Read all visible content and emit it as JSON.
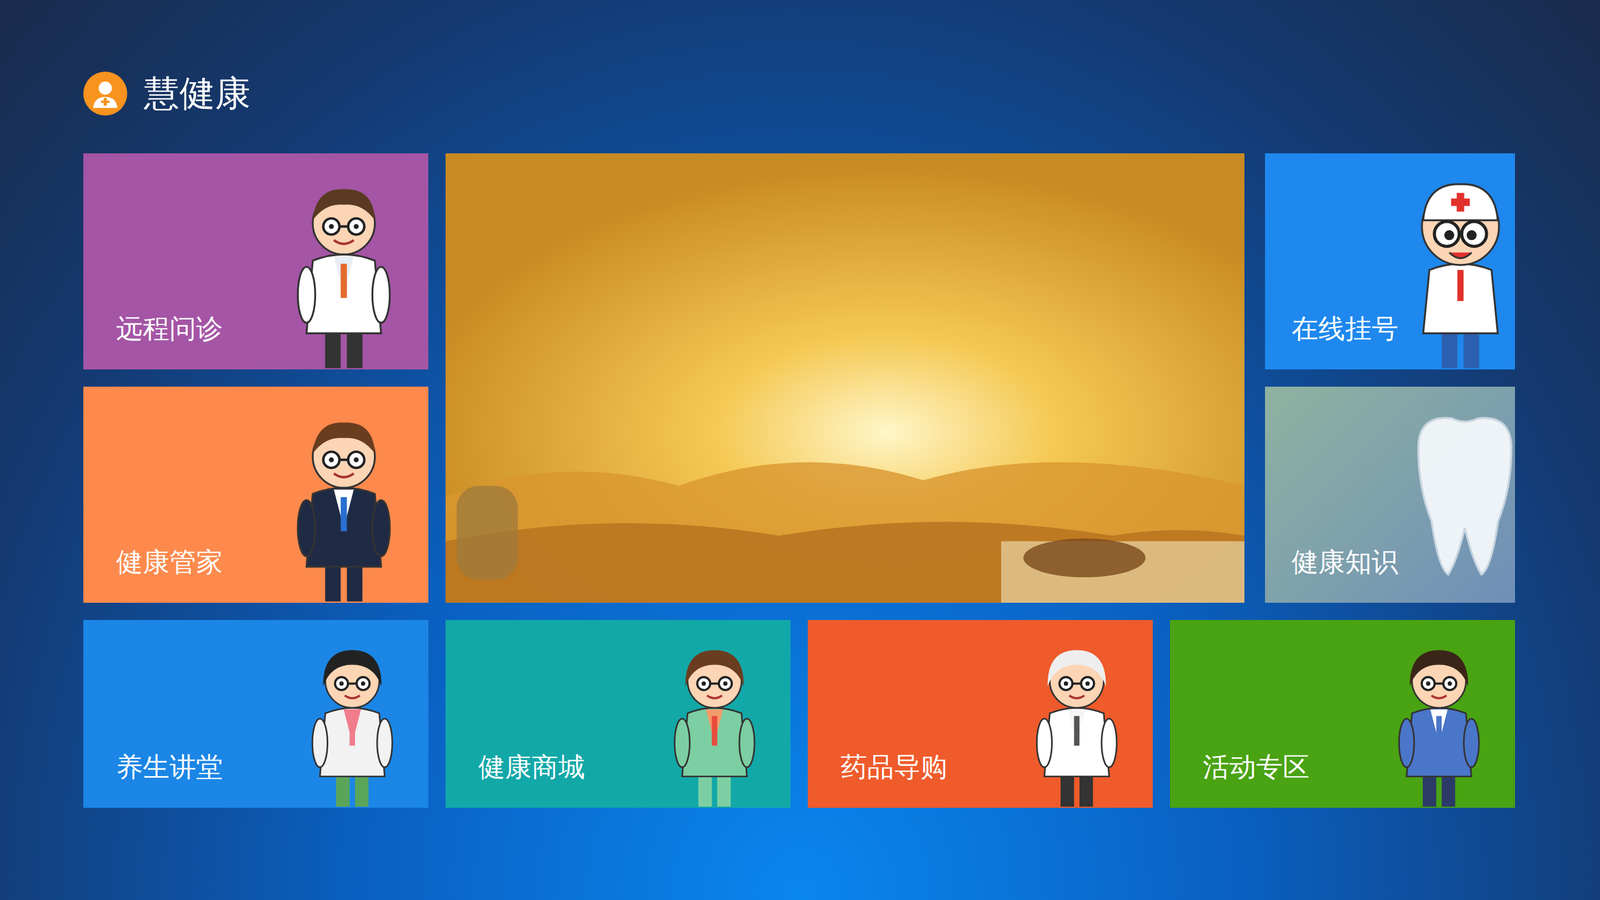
{
  "app": {
    "title": "慧健康"
  },
  "left_tiles": [
    {
      "label": "远程问诊",
      "color": "#a455a5",
      "kind": "illustration"
    },
    {
      "label": "健康管家",
      "color": "#fd8a4c",
      "kind": "illustration"
    }
  ],
  "right_tiles": [
    {
      "label": "在线挂号",
      "color": "#1e88ee",
      "kind": "illustration"
    },
    {
      "label": "健康知识",
      "color": "#6f8fb8",
      "kind": "photo"
    }
  ],
  "bottom_tiles": [
    {
      "label": "养生讲堂",
      "color": "#1b86e6",
      "kind": "illustration"
    },
    {
      "label": "健康商城",
      "color": "#12a8a8",
      "kind": "illustration"
    },
    {
      "label": "药品导购",
      "color": "#ef5b2b",
      "kind": "illustration"
    },
    {
      "label": "活动专区",
      "color": "#49a312",
      "kind": "illustration"
    }
  ]
}
